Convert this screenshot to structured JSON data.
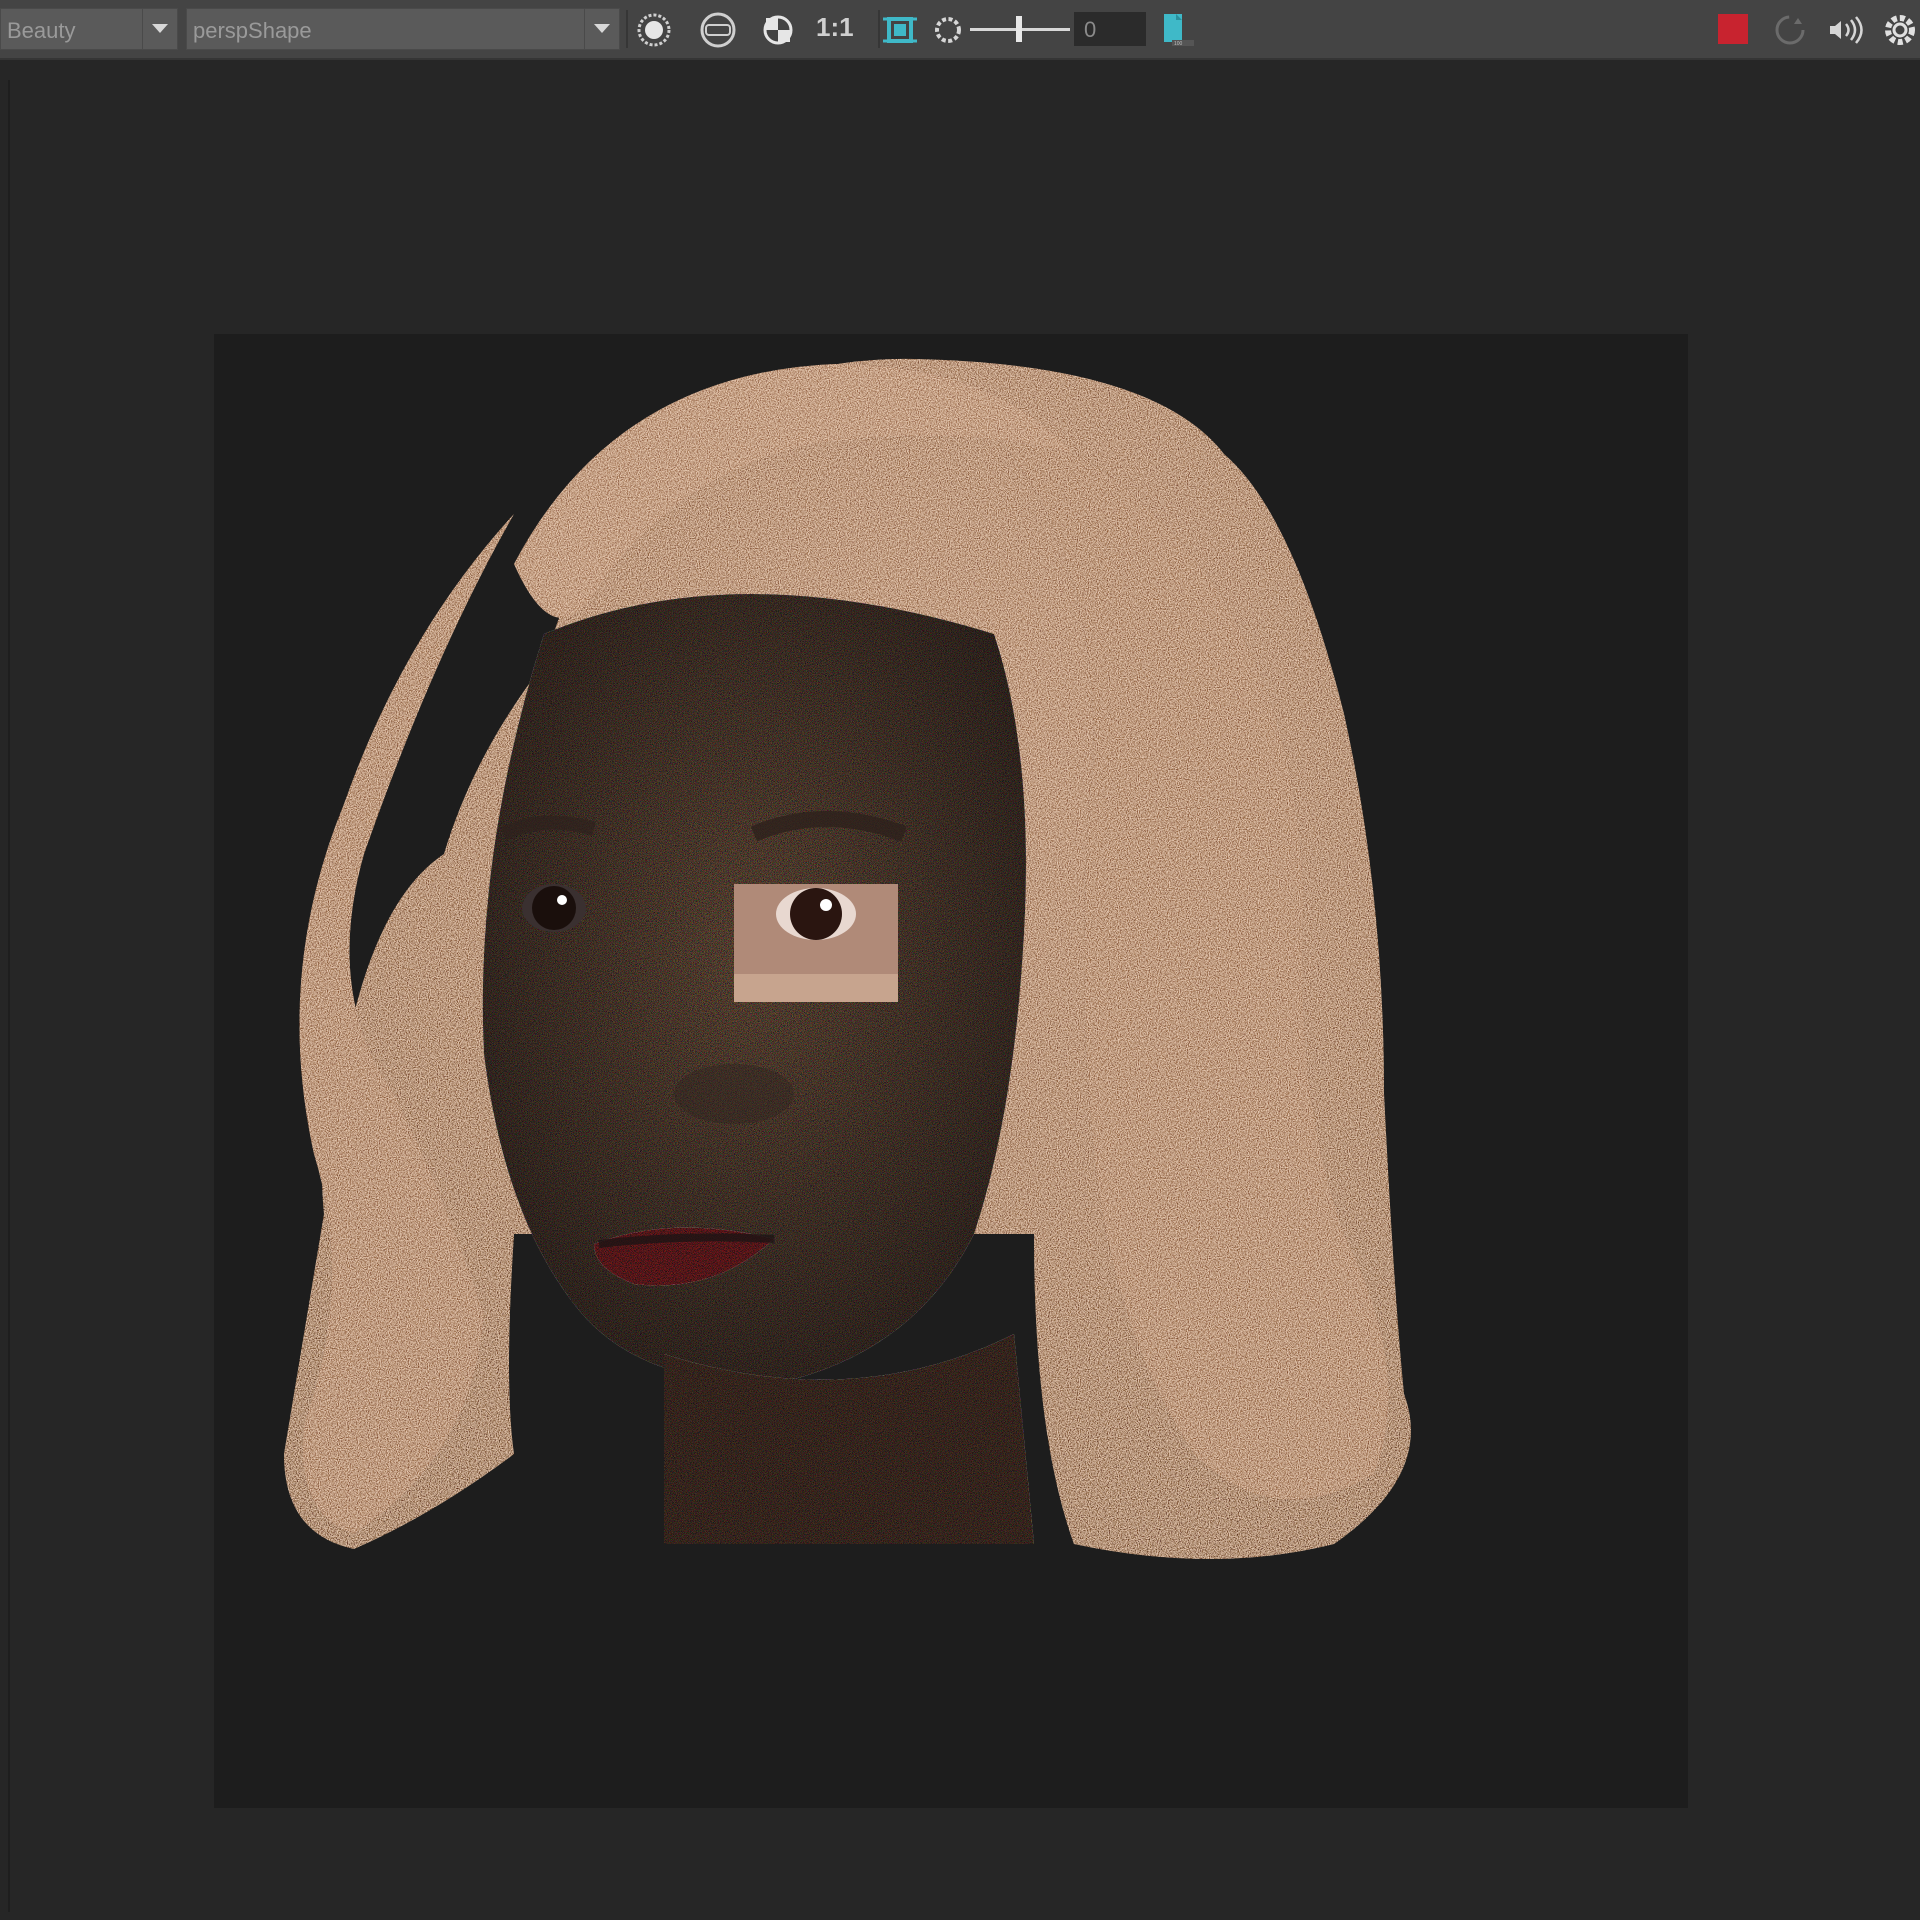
{
  "toolbar": {
    "pass_dropdown": {
      "selected": "Beauty"
    },
    "camera_dropdown": {
      "selected": "perspShape"
    },
    "ratio_label": "1:1",
    "exposure_value": "0",
    "icons": [
      "render-region-icon",
      "snapshot-icon",
      "channel-toggle-icon",
      "crop-region-icon",
      "exposure-gear-icon",
      "save-image-icon",
      "stop-render-icon",
      "refresh-icon",
      "audio-icon",
      "settings-gear-icon"
    ],
    "colors": {
      "stop": "#c8232f",
      "accent": "#3fb9c8"
    }
  },
  "viewport": {
    "render_image": "rendered-portrait-girl-noisy-particles"
  }
}
